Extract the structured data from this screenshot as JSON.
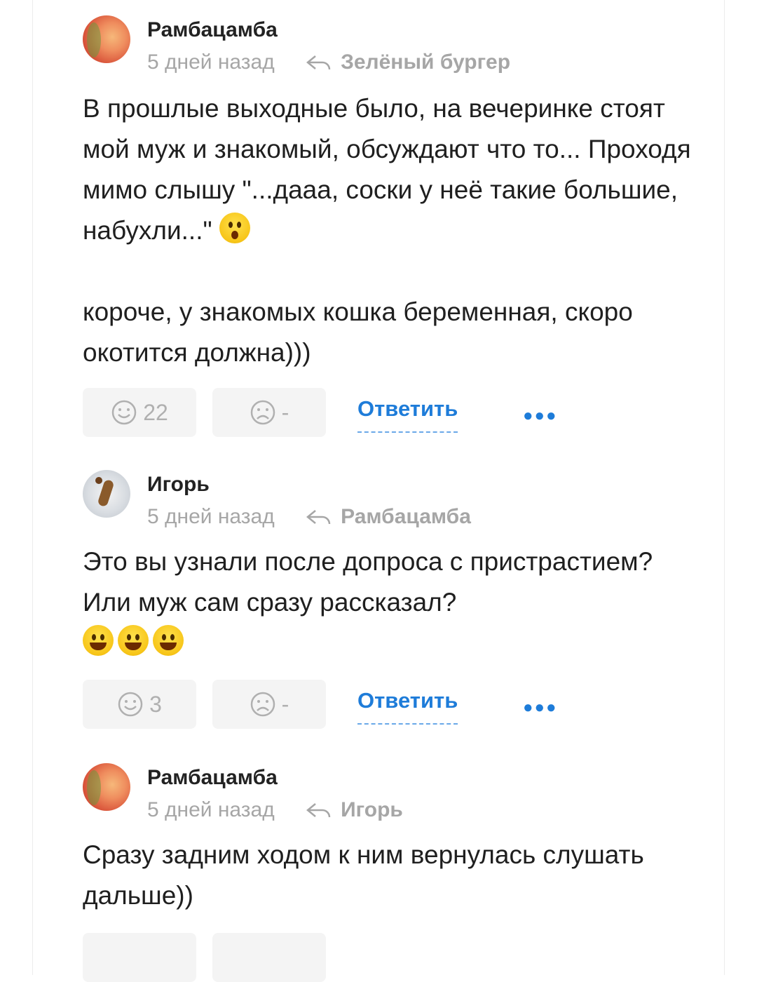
{
  "comments": [
    {
      "author": "Рамбацамба",
      "time": "5 дней назад",
      "reply_to": "Зелёный бургер",
      "avatar": "peach",
      "paragraphs": [
        "В прошлые выходные было, на вечеринке стоят мой муж и знакомый, обсуждают что то... Проходя мимо слышу \"...дааа, соски у неё такие большие, набухли...\"",
        "короче, у знакомых кошка беременная, скоро окотится должна)))"
      ],
      "emoji": "hushed-face",
      "likes": "22",
      "dislikes": "-",
      "reply_label": "Ответить"
    },
    {
      "author": "Игорь",
      "time": "5 дней назад",
      "reply_to": "Рамбацамба",
      "avatar": "cat-photo",
      "paragraphs": [
        "Это вы узнали после допроса с пристрастием? Или муж сам сразу рассказал?"
      ],
      "emoji": "grinning-face x3",
      "likes": "3",
      "dislikes": "-",
      "reply_label": "Ответить"
    },
    {
      "author": "Рамбацамба",
      "time": "5 дней назад",
      "reply_to": "Игорь",
      "avatar": "peach",
      "paragraphs": [
        "Сразу задним ходом к ним вернулась слушать дальше))"
      ]
    }
  ],
  "colors": {
    "link": "#1e7cd9",
    "muted": "#a6a6a6",
    "button_bg": "#f4f4f4"
  }
}
